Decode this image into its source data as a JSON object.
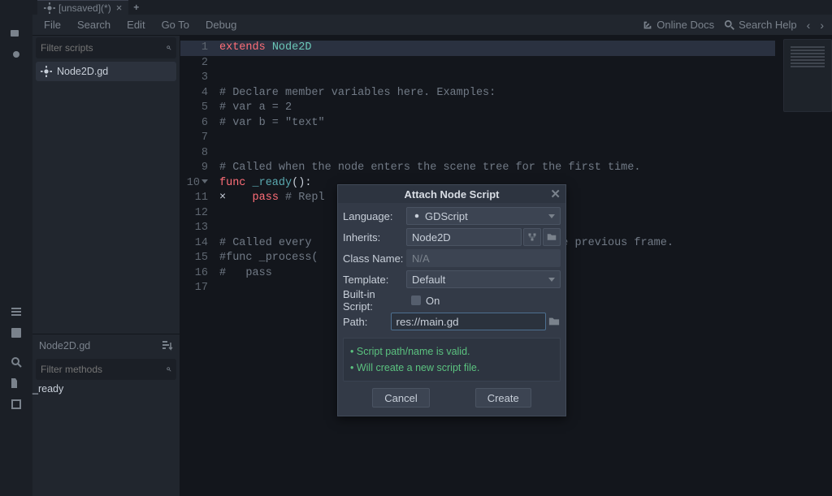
{
  "tabstrip": {
    "active_label": "[unsaved](*)"
  },
  "menu": {
    "file": "File",
    "search": "Search",
    "edit": "Edit",
    "goto": "Go To",
    "debug": "Debug",
    "online_docs": "Online Docs",
    "search_help": "Search Help"
  },
  "side": {
    "filter_scripts_ph": "Filter scripts",
    "script_file": "Node2D.gd",
    "bottom_header": "Node2D.gd",
    "filter_methods_ph": "Filter methods",
    "method": "_ready"
  },
  "code": {
    "l1a": "extends",
    "l1b": " Node2D",
    "l4": "# Declare member variables here. Examples:",
    "l5": "# var a = 2",
    "l6": "# var b = \"text\"",
    "l9": "# Called when the node enters the scene tree for the first time.",
    "l10a": "func",
    "l10b": " _ready",
    "l10c": "():",
    "l11a": "    pass",
    "l11b": " # Repl",
    "l14": "# Called every                                  e the previous frame.",
    "l15": "#func _process(",
    "l16": "#   pass"
  },
  "dialog": {
    "title": "Attach Node Script",
    "language_lbl": "Language:",
    "language_val": "GDScript",
    "inherits_lbl": "Inherits:",
    "inherits_val": "Node2D",
    "class_lbl": "Class Name:",
    "class_val": "N/A",
    "template_lbl": "Template:",
    "template_val": "Default",
    "builtin_lbl": "Built-in Script:",
    "builtin_val": "On",
    "path_lbl": "Path:",
    "path_val": "res://main.gd",
    "valid1": "Script path/name is valid.",
    "valid2": "Will create a new script file.",
    "cancel": "Cancel",
    "create": "Create"
  }
}
